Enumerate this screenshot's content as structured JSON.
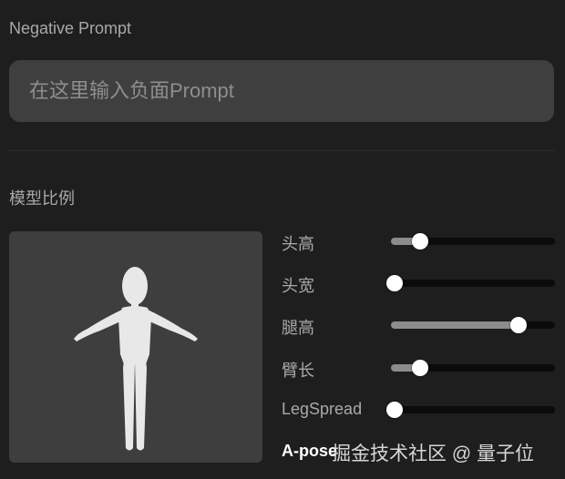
{
  "negative_prompt": {
    "title": "Negative Prompt",
    "placeholder": "在这里输入负面Prompt",
    "value": ""
  },
  "model_ratio": {
    "title": "模型比例",
    "sliders": [
      {
        "label": "头高",
        "value": 0.18
      },
      {
        "label": "头宽",
        "value": 0.0
      },
      {
        "label": "腿高",
        "value": 0.78
      },
      {
        "label": "臂长",
        "value": 0.18
      },
      {
        "label": "LegSpread",
        "value": 0.0
      }
    ],
    "pose_button_label": "A-pose",
    "figure_color": "#e8e8e8"
  },
  "watermark": "掘金技术社区 @ 量子位"
}
